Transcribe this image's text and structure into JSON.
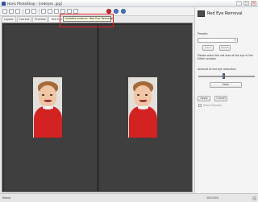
{
  "window": {
    "title": "Haris PhotoShop - [redeyes .jpg]",
    "minimize": "–",
    "maximize": "□",
    "close": "×"
  },
  "toolbar": {
    "icons": [
      "open-icon",
      "save-icon",
      "print-icon",
      "undo-icon",
      "redo-icon",
      "zoom-in-icon",
      "zoom-out-icon",
      "crop-icon",
      "rotate-icon",
      "brush-icon",
      "color-icon",
      "red-eye-icon",
      "info-icon",
      "help-icon"
    ]
  },
  "tooltip": {
    "text": "Isolated product: Red Eye Removal"
  },
  "tabs": [
    "Layout",
    "Current",
    "Preview",
    "Red Eye Removal"
  ],
  "panel": {
    "title": "Red Eye Removal",
    "presets_label": "Presets:",
    "preset_value": "",
    "save_label": "Save",
    "delete_label": "Delete",
    "instruction": "Please select the red area of the eye in the Editor window.",
    "amount_label": "Amount of red eye reduction:",
    "amount_value": 0.45,
    "next_label": "Next",
    "apply_label": "Apply",
    "cancel_label": "Cancel",
    "show_preview_label": "Show Preview"
  },
  "status": {
    "text": "Ready",
    "zoom": "100.00%"
  },
  "colors": {
    "canvas_bg": "#2e2e2e",
    "pane_bg": "#3f3f3f",
    "shirt": "#d32222",
    "tooltip_border": "#e52020"
  }
}
